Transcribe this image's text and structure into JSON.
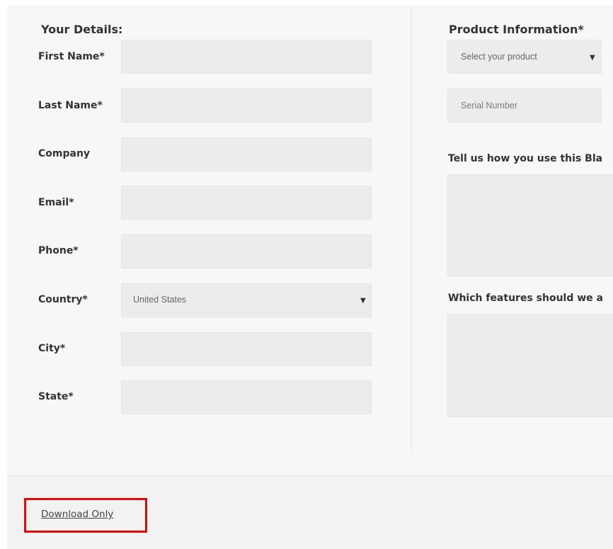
{
  "details": {
    "title": "Your Details:",
    "fields": [
      {
        "label": "First Name*",
        "value": ""
      },
      {
        "label": "Last Name*",
        "value": ""
      },
      {
        "label": "Company",
        "value": ""
      },
      {
        "label": "Email*",
        "value": ""
      },
      {
        "label": "Phone*",
        "value": ""
      },
      {
        "label": "Country*",
        "value": "United States"
      },
      {
        "label": "City*",
        "value": ""
      },
      {
        "label": "State*",
        "value": ""
      }
    ]
  },
  "product": {
    "title": "Product Information*",
    "select_placeholder": "Select your product",
    "serial_placeholder": "Serial Number",
    "use_prompt": "Tell us how you use this Bla",
    "features_prompt": "Which features should we a"
  },
  "footer": {
    "download_link": "Download Only"
  },
  "colors": {
    "highlight": "#e10a0a"
  }
}
